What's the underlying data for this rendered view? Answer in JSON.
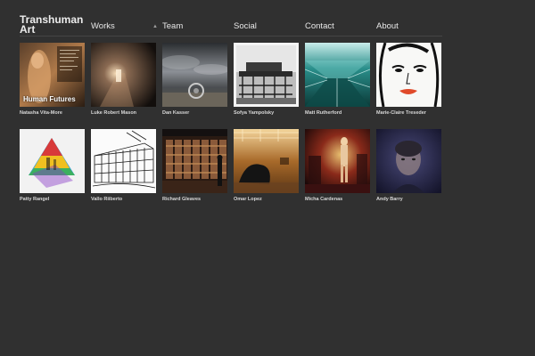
{
  "site": {
    "title": "Transhuman Art"
  },
  "nav": {
    "items": [
      {
        "label": "Works"
      },
      {
        "label": "Team"
      },
      {
        "label": "Social"
      },
      {
        "label": "Contact"
      },
      {
        "label": "About"
      }
    ],
    "dropdown_glyph": "▲"
  },
  "gallery": {
    "row1": [
      {
        "name": "Natasha Vita-More",
        "overlay": "Human Futures",
        "icon": "human-futures-artwork"
      },
      {
        "name": "Luke Robert Mason",
        "icon": "light-beam-photo"
      },
      {
        "name": "Dan Kasser",
        "icon": "stormy-sky-sculpture"
      },
      {
        "name": "Sofya Yampolsky",
        "icon": "architecture-photo"
      },
      {
        "name": "Matt Rutherford",
        "icon": "teal-corridor-photo"
      },
      {
        "name": "Marie-Claire Treseder",
        "icon": "face-illustration"
      }
    ],
    "row2": [
      {
        "name": "Patty Rangel",
        "icon": "colorful-pyramid"
      },
      {
        "name": "Vallo Riiberto",
        "icon": "building-sketch"
      },
      {
        "name": "Richard Gleaves",
        "icon": "gallery-wall-photo"
      },
      {
        "name": "Omar Lopez",
        "icon": "museum-hall-photo"
      },
      {
        "name": "Micha Cardenas",
        "icon": "performance-photo"
      },
      {
        "name": "Andy Barry",
        "icon": "portrait-photo"
      }
    ]
  }
}
